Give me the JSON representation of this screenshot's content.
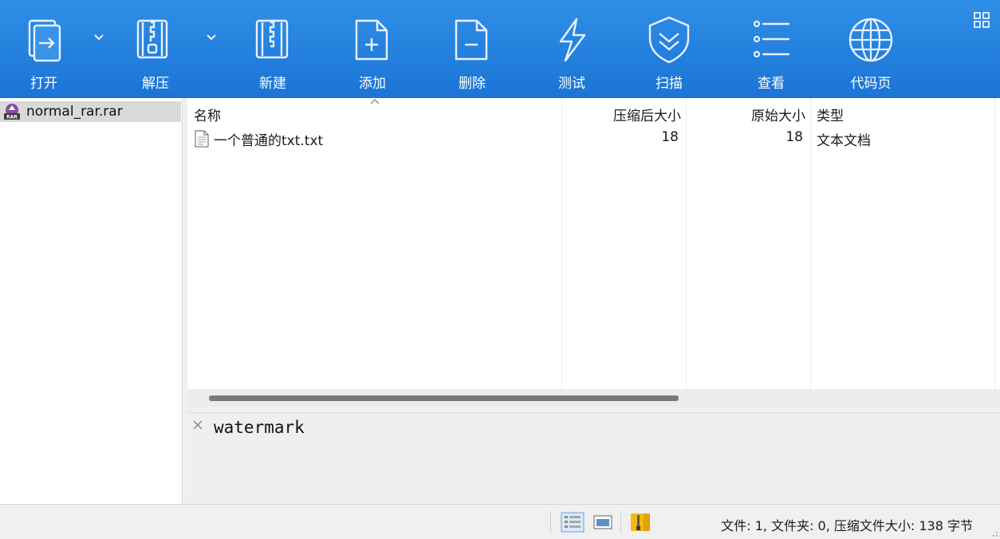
{
  "toolbar": {
    "buttons": [
      {
        "label": "打开",
        "icon": "open-icon"
      },
      {
        "label": "解压",
        "icon": "extract-icon"
      },
      {
        "label": "新建",
        "icon": "new-archive-icon"
      },
      {
        "label": "添加",
        "icon": "add-file-icon"
      },
      {
        "label": "删除",
        "icon": "delete-file-icon"
      },
      {
        "label": "测试",
        "icon": "lightning-icon"
      },
      {
        "label": "扫描",
        "icon": "shield-icon"
      },
      {
        "label": "查看",
        "icon": "list-icon"
      },
      {
        "label": "代码页",
        "icon": "globe-icon"
      }
    ],
    "accent": "#1b74d6"
  },
  "tree": {
    "items": [
      {
        "label": "normal_rar.rar",
        "icon": "rar-archive-icon",
        "selected": true
      }
    ]
  },
  "list": {
    "columns": [
      "名称",
      "压缩后大小",
      "原始大小",
      "类型"
    ],
    "rows": [
      {
        "name": "一个普通的txt.txt",
        "packed": "18",
        "size": "18",
        "type": "文本文档",
        "icon": "text-file-icon"
      }
    ]
  },
  "comment": {
    "text": "watermark"
  },
  "status": {
    "text": "文件: 1, 文件夹: 0, 压缩文件大小: 138 字节"
  }
}
